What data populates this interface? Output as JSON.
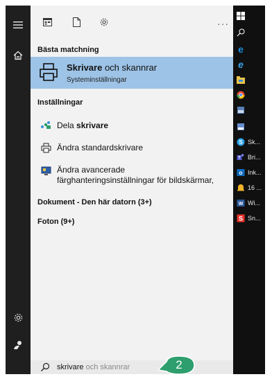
{
  "toolbar": {
    "icons": [
      "apps-icon",
      "document-icon",
      "settings-icon"
    ],
    "more": "···"
  },
  "best_match": {
    "heading": "Bästa matchning",
    "title_bold": "Skrivare",
    "title_rest": " och skannrar",
    "subtitle": "Systeminställningar"
  },
  "settings": {
    "heading": "Inställningar",
    "items": [
      {
        "prefix": "Dela ",
        "bold": "skrivare",
        "icon": "share-icon"
      },
      {
        "prefix": "Ändra standardskrivare",
        "bold": "",
        "icon": "printer-icon"
      },
      {
        "line1": "Ändra avancerade",
        "line2": "färghanteringsinställningar för bildskärmar,",
        "icon": "monitor-icon"
      }
    ]
  },
  "documents": {
    "heading": "Dokument - Den här datorn (3+)"
  },
  "photos": {
    "heading": "Foton (9+)"
  },
  "search": {
    "typed": "skrivare",
    "completion": " och skannrar"
  },
  "callout": {
    "number": "2",
    "color": "#2e9e6e"
  },
  "dock": {
    "items": [
      {
        "icon": "windows-icon",
        "label": ""
      },
      {
        "icon": "search-icon",
        "label": ""
      },
      {
        "icon": "edge-icon",
        "label": ""
      },
      {
        "icon": "ie-icon",
        "label": ""
      },
      {
        "icon": "explorer-icon",
        "label": ""
      },
      {
        "icon": "chrome-icon",
        "label": ""
      },
      {
        "icon": "app-icon",
        "label": ""
      },
      {
        "icon": "app2-icon",
        "label": ""
      },
      {
        "icon": "skype-icon",
        "label": "Sk..."
      },
      {
        "icon": "teams-icon",
        "label": "Bri..."
      },
      {
        "icon": "outlook-icon",
        "label": "Ink..."
      },
      {
        "icon": "bell-icon",
        "label": "16 ..."
      },
      {
        "icon": "word-icon",
        "label": "Wi..."
      },
      {
        "icon": "snagit-icon",
        "label": "Sn..."
      }
    ]
  },
  "colors": {
    "accent": "#9dc3e6",
    "rail": "#1f1f1f",
    "panel": "#f2f2f2",
    "dock": "#101010"
  }
}
